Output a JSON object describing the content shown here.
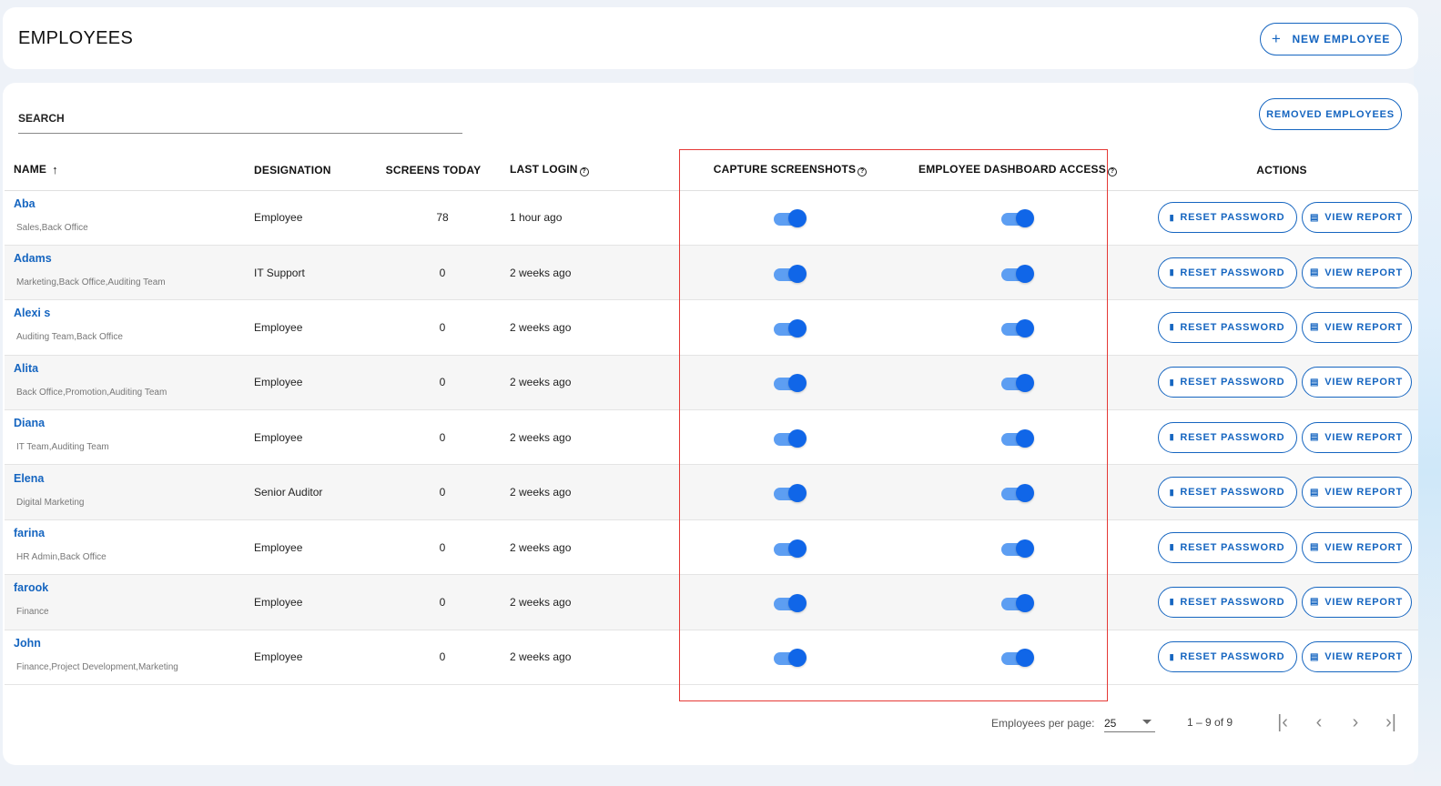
{
  "header": {
    "title": "EMPLOYEES",
    "new_button": "NEW EMPLOYEE",
    "new_icon": "+"
  },
  "toolbar": {
    "search_placeholder": "SEARCH",
    "removed_button": "REMOVED EMPLOYEES"
  },
  "table": {
    "columns": {
      "name": "NAME",
      "designation": "DESIGNATION",
      "screens_today": "SCREENS TODAY",
      "last_login": "LAST LOGIN",
      "capture": "CAPTURE SCREENSHOTS",
      "dashboard": "EMPLOYEE DASHBOARD ACCESS",
      "actions": "ACTIONS"
    },
    "sort_icon": "↑",
    "help_icon": "?",
    "reset_label": "RESET PASSWORD",
    "view_label": "VIEW REPORT",
    "rows": [
      {
        "name": "Aba",
        "groups": "Sales,Back Office",
        "designation": "Employee",
        "screens": "78",
        "last_login": "1 hour ago",
        "capture": true,
        "dashboard": true
      },
      {
        "name": "Adams",
        "groups": "Marketing,Back Office,Auditing Team",
        "designation": "IT Support",
        "screens": "0",
        "last_login": "2 weeks ago",
        "capture": true,
        "dashboard": true
      },
      {
        "name": "Alexi s",
        "groups": "Auditing Team,Back Office",
        "designation": "Employee",
        "screens": "0",
        "last_login": "2 weeks ago",
        "capture": true,
        "dashboard": true
      },
      {
        "name": "Alita",
        "groups": "Back Office,Promotion,Auditing Team",
        "designation": "Employee",
        "screens": "0",
        "last_login": "2 weeks ago",
        "capture": true,
        "dashboard": true
      },
      {
        "name": "Diana",
        "groups": "IT Team,Auditing Team",
        "designation": "Employee",
        "screens": "0",
        "last_login": "2 weeks ago",
        "capture": true,
        "dashboard": true
      },
      {
        "name": "Elena",
        "groups": "Digital Marketing",
        "designation": "Senior Auditor",
        "screens": "0",
        "last_login": "2 weeks ago",
        "capture": true,
        "dashboard": true
      },
      {
        "name": "farina",
        "groups": "HR Admin,Back Office",
        "designation": "Employee",
        "screens": "0",
        "last_login": "2 weeks ago",
        "capture": true,
        "dashboard": true
      },
      {
        "name": "farook",
        "groups": "Finance",
        "designation": "Employee",
        "screens": "0",
        "last_login": "2 weeks ago",
        "capture": true,
        "dashboard": true
      },
      {
        "name": "John",
        "groups": "Finance,Project Development,Marketing",
        "designation": "Employee",
        "screens": "0",
        "last_login": "2 weeks ago",
        "capture": true,
        "dashboard": true
      }
    ]
  },
  "paginator": {
    "per_page_label": "Employees per page:",
    "per_page_value": "25",
    "range": "1 – 9 of 9",
    "first_icon": "|‹",
    "prev_icon": "‹",
    "next_icon": "›",
    "last_icon": "›|"
  },
  "colors": {
    "accent": "#1565c0",
    "toggle_on": "#1066e8",
    "highlight": "#e53935"
  }
}
